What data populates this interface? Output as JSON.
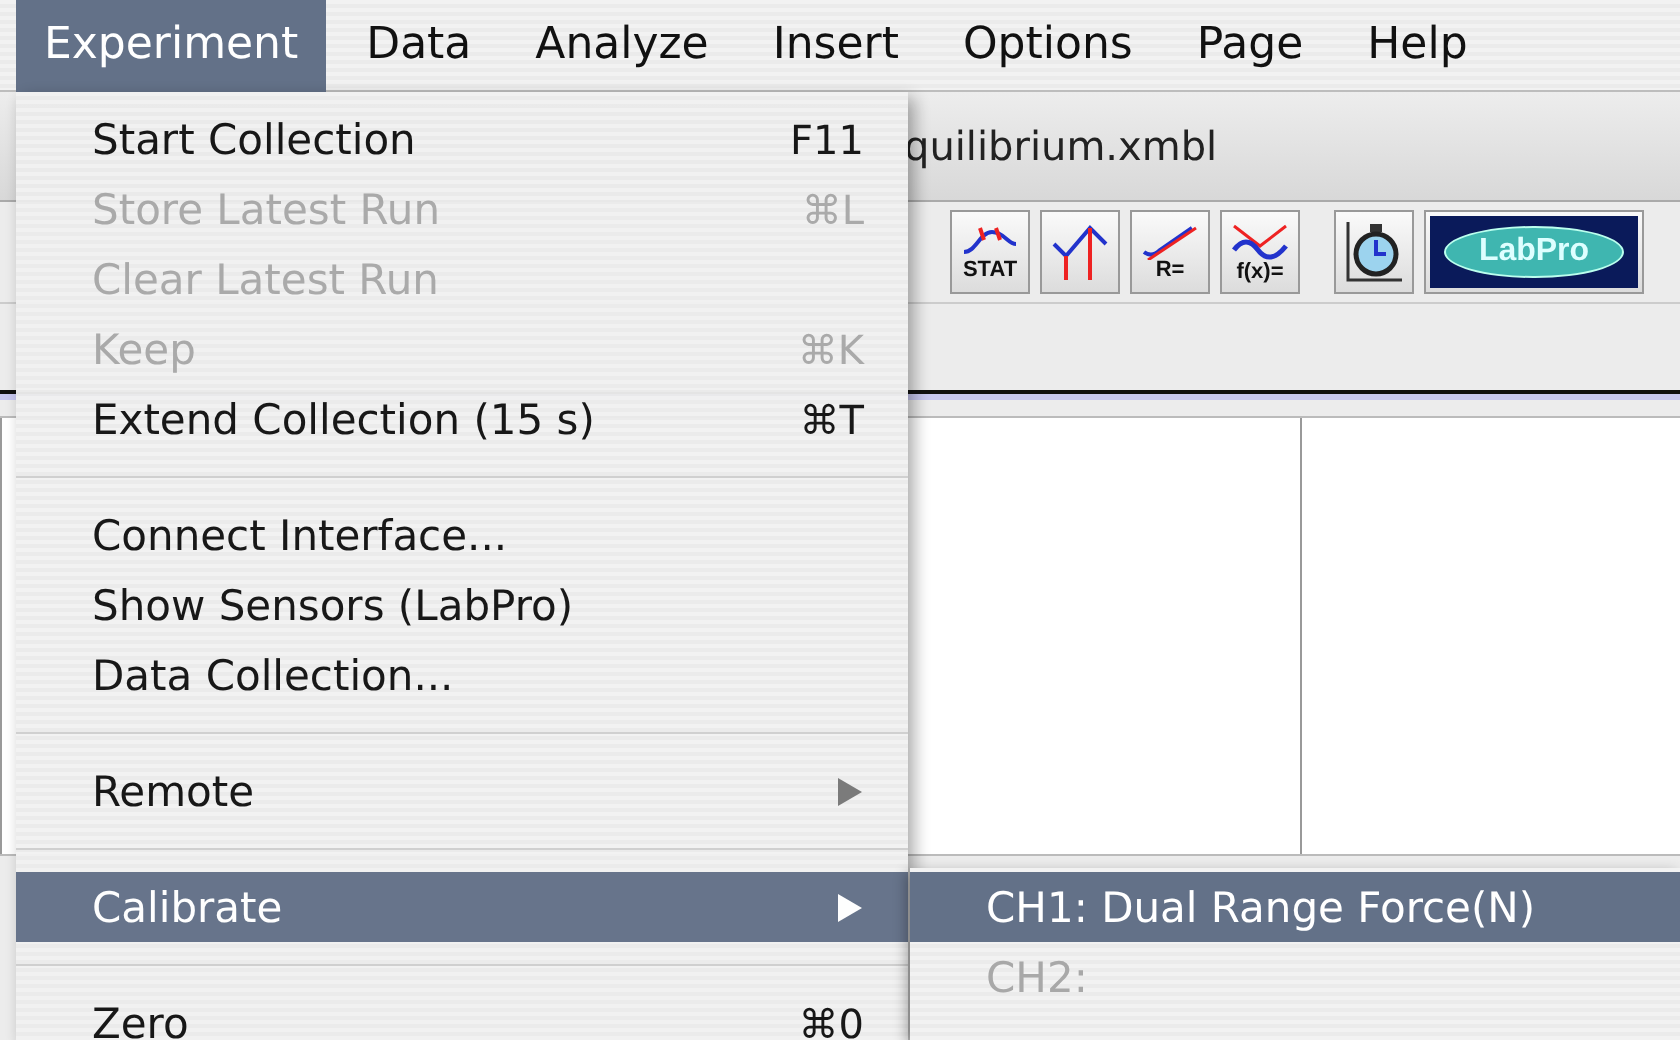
{
  "menubar": {
    "items": [
      {
        "label": "Experiment",
        "selected": true
      },
      {
        "label": "Data",
        "selected": false
      },
      {
        "label": "Analyze",
        "selected": false
      },
      {
        "label": "Insert",
        "selected": false
      },
      {
        "label": "Options",
        "selected": false
      },
      {
        "label": "Page",
        "selected": false
      },
      {
        "label": "Help",
        "selected": false
      }
    ]
  },
  "window": {
    "title": "quilibrium.xmbl",
    "toolbar": [
      {
        "kind": "stat",
        "label": "STAT"
      },
      {
        "kind": "peak"
      },
      {
        "kind": "linear",
        "label": "R="
      },
      {
        "kind": "curve",
        "label": "f(x)="
      },
      {
        "kind": "timer"
      },
      {
        "kind": "labpro",
        "label": "LabPro"
      }
    ]
  },
  "menu": {
    "items": [
      {
        "kind": "item",
        "label": "Start Collection",
        "shortcut": "F11",
        "disabled": false,
        "selected": false
      },
      {
        "kind": "item",
        "label": "Store Latest Run",
        "shortcut": "⌘L",
        "disabled": true,
        "selected": false
      },
      {
        "kind": "item",
        "label": "Clear Latest Run",
        "disabled": true,
        "selected": false
      },
      {
        "kind": "item",
        "label": "Keep",
        "shortcut": "⌘K",
        "disabled": true,
        "selected": false
      },
      {
        "kind": "item",
        "label": "Extend Collection (15 s)",
        "shortcut": "⌘T",
        "disabled": false,
        "selected": false
      },
      {
        "kind": "separator"
      },
      {
        "kind": "item",
        "label": "Connect Interface...",
        "disabled": false,
        "selected": false
      },
      {
        "kind": "item",
        "label": "Show Sensors (LabPro)",
        "disabled": false,
        "selected": false
      },
      {
        "kind": "item",
        "label": "Data Collection...",
        "disabled": false,
        "selected": false
      },
      {
        "kind": "separator"
      },
      {
        "kind": "submenu",
        "label": "Remote",
        "disabled": false,
        "selected": false
      },
      {
        "kind": "separator"
      },
      {
        "kind": "submenu",
        "label": "Calibrate",
        "disabled": false,
        "selected": true
      },
      {
        "kind": "separator"
      },
      {
        "kind": "item",
        "label": "Zero",
        "shortcut": "⌘0",
        "disabled": false,
        "selected": false
      }
    ]
  },
  "submenu": {
    "items": [
      {
        "label": "CH1: Dual Range Force(N)",
        "disabled": false,
        "selected": true
      },
      {
        "label": "CH2:",
        "disabled": true,
        "selected": false
      }
    ]
  }
}
